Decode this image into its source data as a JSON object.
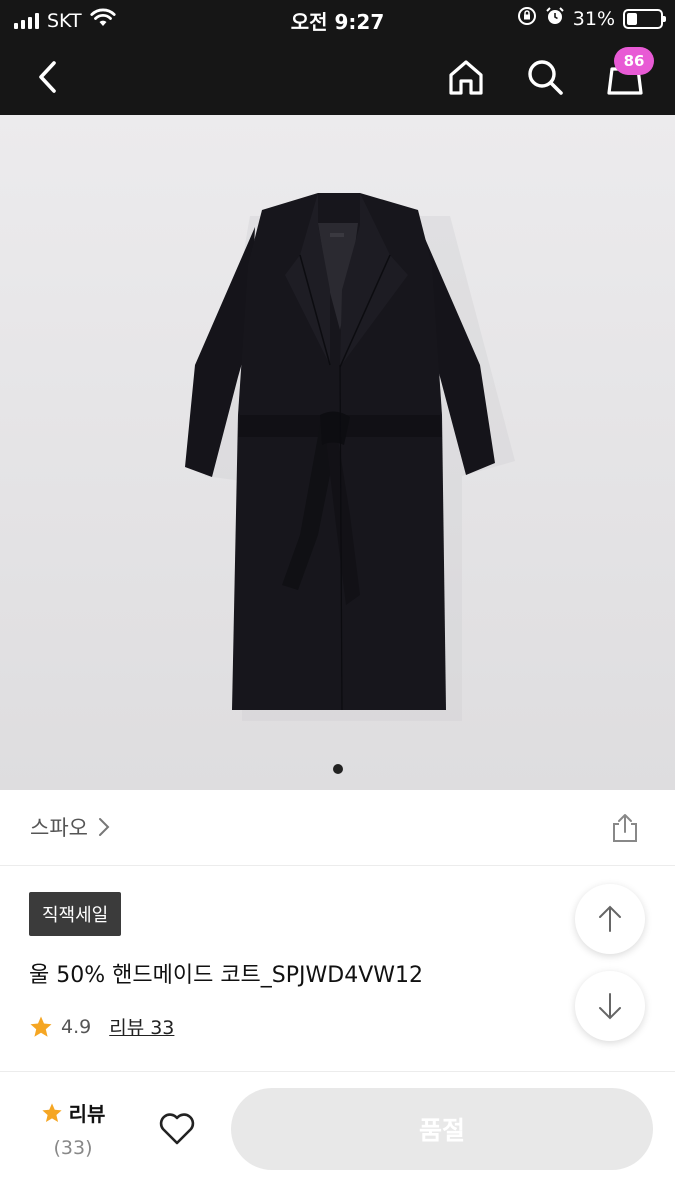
{
  "status_bar": {
    "carrier": "SKT",
    "time": "오전 9:27",
    "battery_percent": "31%",
    "battery_level": 0.31
  },
  "nav": {
    "cart_count": "86"
  },
  "product_image": {
    "current_slide": 1,
    "total_slides": 1
  },
  "brand": {
    "name": "스파오",
    "chevron": "›"
  },
  "product": {
    "tag": "직잭세일",
    "title": "울 50% 핸드메이드 코트_SPJWD4VW12",
    "rating": "4.9",
    "review_label": "리뷰 33"
  },
  "bottom_bar": {
    "review_label": "리뷰",
    "review_count": "(33)",
    "action_label": "품절"
  },
  "colors": {
    "header_bg": "#161616",
    "badge": "#e85ad5",
    "star": "#f5a623",
    "tag_bg": "#3b3b3b",
    "disabled_button": "#e8e8e8"
  },
  "icons": [
    "back-icon",
    "home-icon",
    "search-icon",
    "cart-icon",
    "share-icon",
    "arrow-up-icon",
    "arrow-down-icon",
    "star-icon",
    "heart-icon",
    "wifi-icon",
    "alarm-icon",
    "lock-rotation-icon",
    "battery-icon"
  ]
}
